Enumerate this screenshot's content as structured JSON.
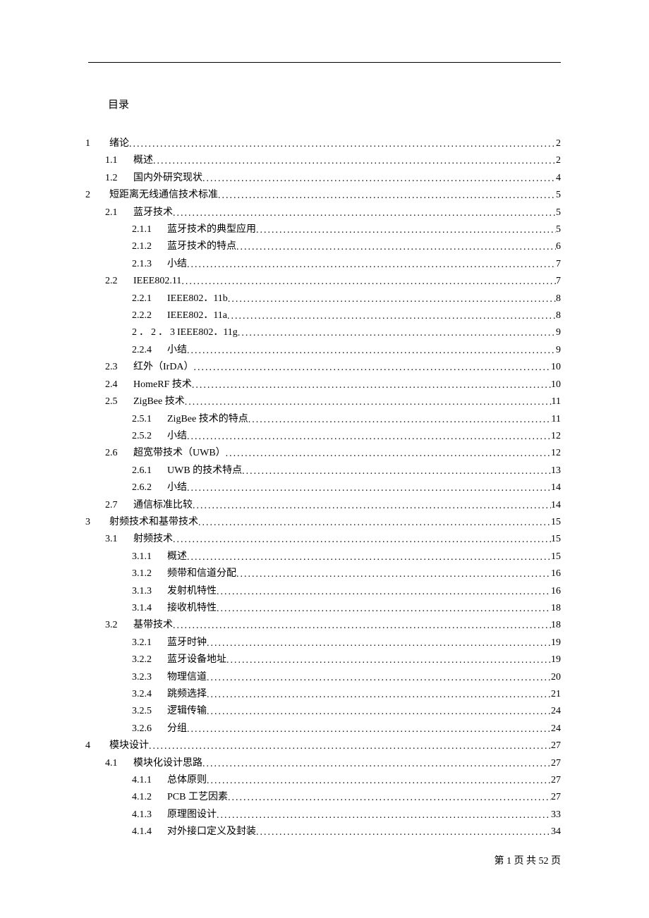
{
  "title": "目录",
  "footer": "第 1 页 共 52 页",
  "entries": [
    {
      "level": 1,
      "num": "1",
      "text": "绪论",
      "page": "2"
    },
    {
      "level": 2,
      "num": "1.1",
      "text": "概述",
      "page": "2"
    },
    {
      "level": 2,
      "num": "1.2",
      "text": "国内外研究现状",
      "page": "4"
    },
    {
      "level": 1,
      "num": "2",
      "text": "短距离无线通信技术标准",
      "page": "5"
    },
    {
      "level": 2,
      "num": "2.1",
      "text": "蓝牙技术",
      "page": "5"
    },
    {
      "level": 3,
      "num": "2.1.1",
      "text": "蓝牙技术的典型应用",
      "page": "5"
    },
    {
      "level": 3,
      "num": "2.1.2",
      "text": "蓝牙技术的特点",
      "page": "6"
    },
    {
      "level": 3,
      "num": "2.1.3",
      "text": "小结",
      "page": "7"
    },
    {
      "level": 2,
      "num": "2.2",
      "text": "IEEE802.11",
      "page": "7"
    },
    {
      "level": 3,
      "num": "2.2.1",
      "text": "IEEE802．11b",
      "page": "8"
    },
    {
      "level": 3,
      "num": "2.2.2",
      "text": "IEEE802．11a",
      "page": "8"
    },
    {
      "level": 3,
      "num": "2．2．3",
      "text": "IEEE802．11g",
      "page": "9",
      "wide": true
    },
    {
      "level": 3,
      "num": "2.2.4",
      "text": "小结",
      "page": "9"
    },
    {
      "level": 2,
      "num": "2.3",
      "text": "红外（IrDA）",
      "page": "10"
    },
    {
      "level": 2,
      "num": "2.4",
      "text": "HomeRF 技术",
      "page": "10"
    },
    {
      "level": 2,
      "num": "2.5",
      "text": "ZigBee 技术",
      "page": "11"
    },
    {
      "level": 3,
      "num": "2.5.1",
      "text": "ZigBee 技术的特点",
      "page": "11"
    },
    {
      "level": 3,
      "num": "2.5.2",
      "text": "小结",
      "page": "12"
    },
    {
      "level": 2,
      "num": "2.6",
      "text": "超宽带技术（UWB）",
      "page": "12"
    },
    {
      "level": 3,
      "num": "2.6.1",
      "text": "UWB 的技术特点",
      "page": "13"
    },
    {
      "level": 3,
      "num": "2.6.2",
      "text": "小结",
      "page": "14"
    },
    {
      "level": 2,
      "num": "2.7",
      "text": "通信标准比较",
      "page": "14"
    },
    {
      "level": 1,
      "num": "3",
      "text": "射频技术和基带技术",
      "page": "15"
    },
    {
      "level": 2,
      "num": "3.1",
      "text": "射频技术",
      "page": "15"
    },
    {
      "level": 3,
      "num": "3.1.1",
      "text": "概述",
      "page": "15"
    },
    {
      "level": 3,
      "num": "3.1.2",
      "text": "频带和信道分配",
      "page": "16"
    },
    {
      "level": 3,
      "num": "3.1.3",
      "text": "发射机特性",
      "page": "16"
    },
    {
      "level": 3,
      "num": "3.1.4",
      "text": "接收机特性",
      "page": "18"
    },
    {
      "level": 2,
      "num": "3.2",
      "text": "基带技术",
      "page": "18"
    },
    {
      "level": 3,
      "num": "3.2.1",
      "text": "蓝牙时钟",
      "page": "19"
    },
    {
      "level": 3,
      "num": "3.2.2",
      "text": "蓝牙设备地址",
      "page": "19"
    },
    {
      "level": 3,
      "num": "3.2.3",
      "text": "物理信道",
      "page": "20"
    },
    {
      "level": 3,
      "num": "3.2.4",
      "text": "跳频选择",
      "page": "21"
    },
    {
      "level": 3,
      "num": "3.2.5",
      "text": "逻辑传输",
      "page": "24"
    },
    {
      "level": 3,
      "num": "3.2.6",
      "text": "分组",
      "page": "24"
    },
    {
      "level": 1,
      "num": "4",
      "text": "模块设计",
      "page": "27"
    },
    {
      "level": 2,
      "num": "4.1",
      "text": "模块化设计思路",
      "page": "27"
    },
    {
      "level": 3,
      "num": "4.1.1",
      "text": "总体原则",
      "page": "27"
    },
    {
      "level": 3,
      "num": "4.1.2",
      "text": "PCB 工艺因素",
      "page": "27"
    },
    {
      "level": 3,
      "num": "4.1.3",
      "text": "原理图设计",
      "page": "33"
    },
    {
      "level": 3,
      "num": "4.1.4",
      "text": "对外接口定义及封装",
      "page": "34"
    }
  ]
}
